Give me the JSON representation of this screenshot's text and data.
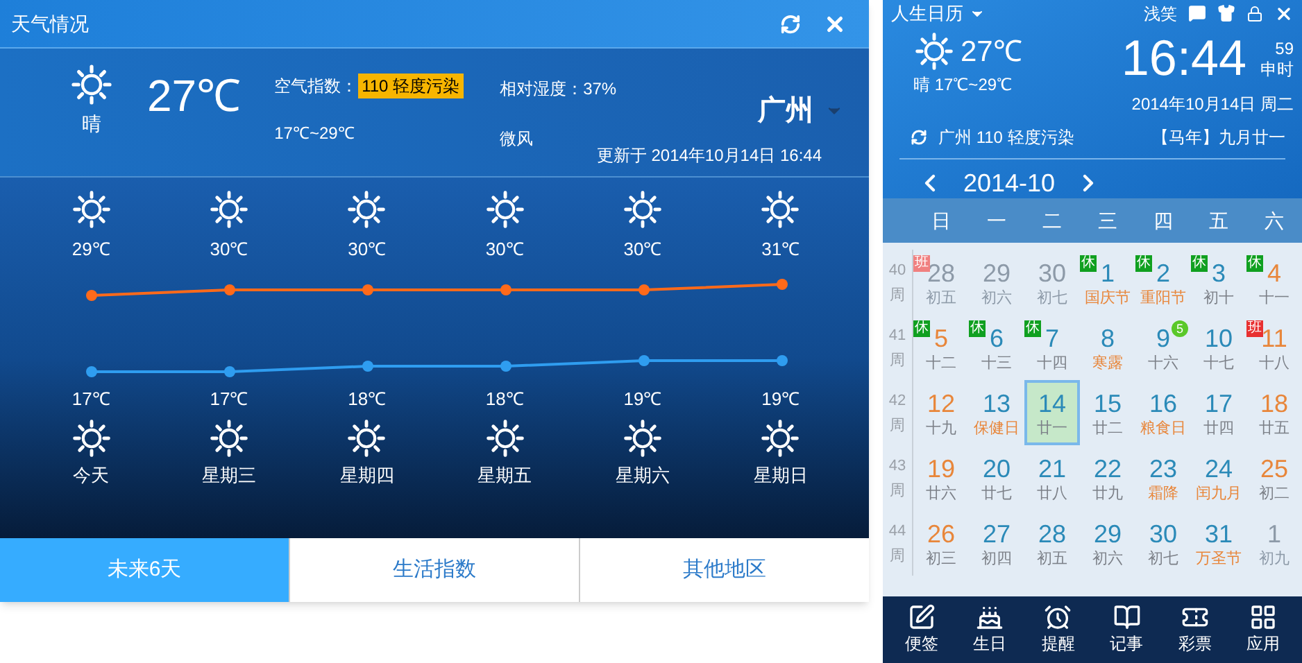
{
  "weather": {
    "title": "天气情况",
    "current": {
      "temp": "27℃",
      "condition": "晴",
      "aqi_label": "空气指数：",
      "aqi": "110 轻度污染",
      "range": "17℃~29℃",
      "humidity": "相对湿度：37%",
      "wind": "微风",
      "city": "广州",
      "updated": "更新于 2014年10月14日 16:44"
    },
    "forecast": [
      {
        "high": "29℃",
        "low": "17℃",
        "label": "今天"
      },
      {
        "high": "30℃",
        "low": "17℃",
        "label": "星期三"
      },
      {
        "high": "30℃",
        "low": "18℃",
        "label": "星期四"
      },
      {
        "high": "30℃",
        "low": "18℃",
        "label": "星期五"
      },
      {
        "high": "30℃",
        "low": "19℃",
        "label": "星期六"
      },
      {
        "high": "31℃",
        "low": "19℃",
        "label": "星期日"
      }
    ],
    "tabs": [
      {
        "label": "未来6天",
        "selected": true
      },
      {
        "label": "生活指数",
        "selected": false
      },
      {
        "label": "其他地区",
        "selected": false
      }
    ]
  },
  "calendar": {
    "title": "人生日历",
    "user": "浅笑",
    "temp": "27℃",
    "weather": "晴 17℃~29℃",
    "time": "16:44",
    "seconds": "59",
    "shichen": "申时",
    "date": "2014年10月14日 周二",
    "air": "广州 110 轻度污染",
    "lunar": "【马年】九月廿一",
    "month": "2014-10",
    "weekdays": [
      "日",
      "一",
      "二",
      "三",
      "四",
      "五",
      "六"
    ],
    "weeks": [
      {
        "num": "40",
        "label": "周",
        "days": [
          {
            "day": "28",
            "sub": "初五",
            "kind": "other",
            "festival": false,
            "selected": false,
            "tag": {
              "text": "班",
              "color": "#f08080"
            }
          },
          {
            "day": "29",
            "sub": "初六",
            "kind": "other",
            "festival": false,
            "selected": false
          },
          {
            "day": "30",
            "sub": "初七",
            "kind": "other",
            "festival": false,
            "selected": false
          },
          {
            "day": "1",
            "sub": "国庆节",
            "kind": "weekday",
            "festival": true,
            "selected": false,
            "tag": {
              "text": "休",
              "color": "#10a020"
            }
          },
          {
            "day": "2",
            "sub": "重阳节",
            "kind": "weekday",
            "festival": true,
            "selected": false,
            "tag": {
              "text": "休",
              "color": "#10a020"
            }
          },
          {
            "day": "3",
            "sub": "初十",
            "kind": "weekday",
            "festival": false,
            "selected": false,
            "tag": {
              "text": "休",
              "color": "#10a020"
            }
          },
          {
            "day": "4",
            "sub": "十一",
            "kind": "weekend",
            "festival": false,
            "selected": false,
            "tag": {
              "text": "休",
              "color": "#10a020"
            }
          }
        ]
      },
      {
        "num": "41",
        "label": "周",
        "days": [
          {
            "day": "5",
            "sub": "十二",
            "kind": "weekend",
            "festival": false,
            "selected": false,
            "tag": {
              "text": "休",
              "color": "#10a020"
            }
          },
          {
            "day": "6",
            "sub": "十三",
            "kind": "weekday",
            "festival": false,
            "selected": false,
            "tag": {
              "text": "休",
              "color": "#10a020"
            }
          },
          {
            "day": "7",
            "sub": "十四",
            "kind": "weekday",
            "festival": false,
            "selected": false,
            "tag": {
              "text": "休",
              "color": "#10a020"
            }
          },
          {
            "day": "8",
            "sub": "寒露",
            "kind": "weekday",
            "festival": true,
            "selected": false
          },
          {
            "day": "9",
            "sub": "十六",
            "kind": "weekday",
            "festival": false,
            "selected": false,
            "count": "5"
          },
          {
            "day": "10",
            "sub": "十七",
            "kind": "weekday",
            "festival": false,
            "selected": false
          },
          {
            "day": "11",
            "sub": "十八",
            "kind": "weekend",
            "festival": false,
            "selected": false,
            "tag": {
              "text": "班",
              "color": "#e83030"
            }
          }
        ]
      },
      {
        "num": "42",
        "label": "周",
        "days": [
          {
            "day": "12",
            "sub": "十九",
            "kind": "weekend",
            "festival": false,
            "selected": false
          },
          {
            "day": "13",
            "sub": "保健日",
            "kind": "weekday",
            "festival": true,
            "selected": false
          },
          {
            "day": "14",
            "sub": "廿一",
            "kind": "weekday",
            "festival": false,
            "selected": true
          },
          {
            "day": "15",
            "sub": "廿二",
            "kind": "weekday",
            "festival": false,
            "selected": false
          },
          {
            "day": "16",
            "sub": "粮食日",
            "kind": "weekday",
            "festival": true,
            "selected": false
          },
          {
            "day": "17",
            "sub": "廿四",
            "kind": "weekday",
            "festival": false,
            "selected": false
          },
          {
            "day": "18",
            "sub": "廿五",
            "kind": "weekend",
            "festival": false,
            "selected": false
          }
        ]
      },
      {
        "num": "43",
        "label": "周",
        "days": [
          {
            "day": "19",
            "sub": "廿六",
            "kind": "weekend",
            "festival": false,
            "selected": false
          },
          {
            "day": "20",
            "sub": "廿七",
            "kind": "weekday",
            "festival": false,
            "selected": false
          },
          {
            "day": "21",
            "sub": "廿八",
            "kind": "weekday",
            "festival": false,
            "selected": false
          },
          {
            "day": "22",
            "sub": "廿九",
            "kind": "weekday",
            "festival": false,
            "selected": false
          },
          {
            "day": "23",
            "sub": "霜降",
            "kind": "weekday",
            "festival": true,
            "selected": false
          },
          {
            "day": "24",
            "sub": "闰九月",
            "kind": "weekday",
            "festival": true,
            "selected": false
          },
          {
            "day": "25",
            "sub": "初二",
            "kind": "weekend",
            "festival": false,
            "selected": false
          }
        ]
      },
      {
        "num": "44",
        "label": "周",
        "days": [
          {
            "day": "26",
            "sub": "初三",
            "kind": "weekend",
            "festival": false,
            "selected": false
          },
          {
            "day": "27",
            "sub": "初四",
            "kind": "weekday",
            "festival": false,
            "selected": false
          },
          {
            "day": "28",
            "sub": "初五",
            "kind": "weekday",
            "festival": false,
            "selected": false
          },
          {
            "day": "29",
            "sub": "初六",
            "kind": "weekday",
            "festival": false,
            "selected": false
          },
          {
            "day": "30",
            "sub": "初七",
            "kind": "weekday",
            "festival": false,
            "selected": false
          },
          {
            "day": "31",
            "sub": "万圣节",
            "kind": "weekday",
            "festival": true,
            "selected": false
          },
          {
            "day": "1",
            "sub": "初九",
            "kind": "other",
            "festival": false,
            "selected": false
          }
        ]
      }
    ],
    "tools": [
      {
        "label": "便签",
        "kind": "note"
      },
      {
        "label": "生日",
        "kind": "cake"
      },
      {
        "label": "提醒",
        "kind": "alarm"
      },
      {
        "label": "记事",
        "kind": "book"
      },
      {
        "label": "彩票",
        "kind": "ticket"
      },
      {
        "label": "应用",
        "kind": "apps"
      }
    ]
  }
}
